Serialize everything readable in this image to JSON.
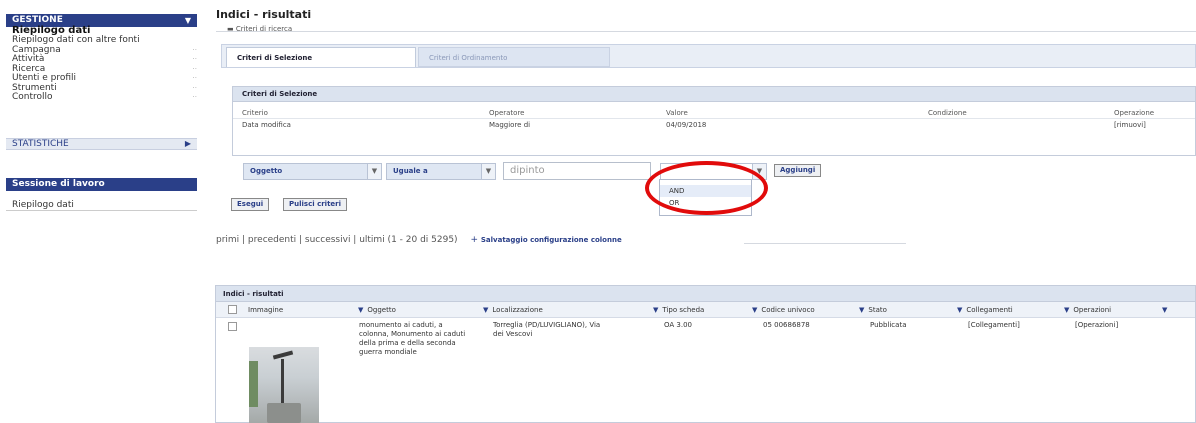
{
  "sidebar": {
    "gestione": "GESTIONE",
    "items": [
      {
        "label": "Riepilogo dati"
      },
      {
        "label": "Riepilogo dati con altre fonti"
      },
      {
        "label": "Campagna"
      },
      {
        "label": "Attività"
      },
      {
        "label": "Ricerca"
      },
      {
        "label": "Utenti e profili"
      },
      {
        "label": "Strumenti"
      },
      {
        "label": "Controllo"
      }
    ],
    "statistiche": "STATISTICHE",
    "sessione": "Sessione di lavoro",
    "sessione_item": "Riepilogo dati"
  },
  "page": {
    "title": "Indici - risultati",
    "legend": "Criteri di ricerca"
  },
  "tabs": {
    "selezione": "Criteri di Selezione",
    "ordinamento": "Criteri di Ordinamento"
  },
  "criteria": {
    "header": "Criteri di Selezione",
    "columns": [
      "Criterio",
      "Operatore",
      "Valore",
      "Condizione",
      "Operazione"
    ],
    "row": [
      "Data modifica",
      "Maggiore di",
      "04/09/2018",
      "",
      "[rimuovi]"
    ]
  },
  "filter": {
    "field": "Oggetto",
    "operator": "Uguale a",
    "value": "dipinto",
    "add_button": "Aggiungi",
    "menu_options": [
      "AND",
      "OR"
    ]
  },
  "actions": {
    "execute": "Esegui",
    "clear": "Pulisci criteri"
  },
  "pager": {
    "text": "primi | precedenti | successivi | ultimi (1 - 20 di 5295)",
    "save_config": "Salvataggio configurazione colonne"
  },
  "results": {
    "header": "Indici - risultati",
    "columns": [
      "Immagine",
      "Oggetto",
      "Localizzazione",
      "Tipo scheda",
      "Codice univoco",
      "Stato",
      "Collegamenti",
      "Operazioni"
    ],
    "row": {
      "oggetto": "monumento ai caduti, a colonna, Monumento ai caduti della prima e della seconda guerra mondiale",
      "localizzazione": "Torreglia (PD/LUVIGLIANO), Via dei Vescovi",
      "tipo": "OA 3.00",
      "codice": "05 00686878",
      "stato": "Pubblicata",
      "collegamenti": "[Collegamenti]",
      "operazioni": "[Operazioni]"
    }
  },
  "colors": {
    "navy": "#2a3f88",
    "panel_header": "#dbe3ef",
    "highlight_ring": "#e10b0b"
  }
}
